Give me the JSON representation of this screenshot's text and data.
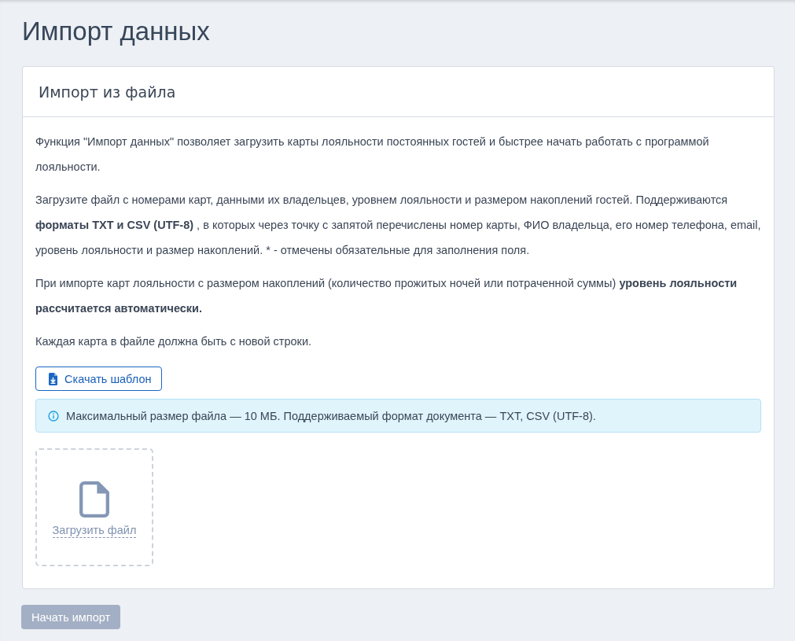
{
  "page": {
    "title": "Импорт данных"
  },
  "card": {
    "title": "Импорт из файла",
    "paragraphs": [
      "Функция \"Импорт данных\" позволяет загрузить карты лояльности постоянных гостей и быстрее начать работать с программой лояльности.",
      "Загрузите файл с номерами карт, данными их владельцев, уровнем лояльности и размером накоплений гостей. Поддерживаются **форматы TXT и CSV (UTF-8)** , в которых через точку с запятой перечислены номер карты, ФИО владельца, его номер телефона, email, уровень лояльности и размер накоплений. * - отмечены обязательные для заполнения поля.",
      "При импорте карт лояльности с размером накоплений (количество прожитых ночей или потраченной суммы) **уровень лояльности рассчитается автоматически.**",
      "Каждая карта в файле должна быть с новой строки."
    ],
    "download_button": {
      "label": "Скачать шаблон"
    },
    "info_alert": {
      "text": "Максимальный размер файла — 10 МБ. Поддерживаемый формат документа — TXT, CSV (UTF-8)."
    },
    "dropzone": {
      "label": "Загрузить файл"
    }
  },
  "start_button": {
    "label": "Начать импорт",
    "disabled": true
  }
}
